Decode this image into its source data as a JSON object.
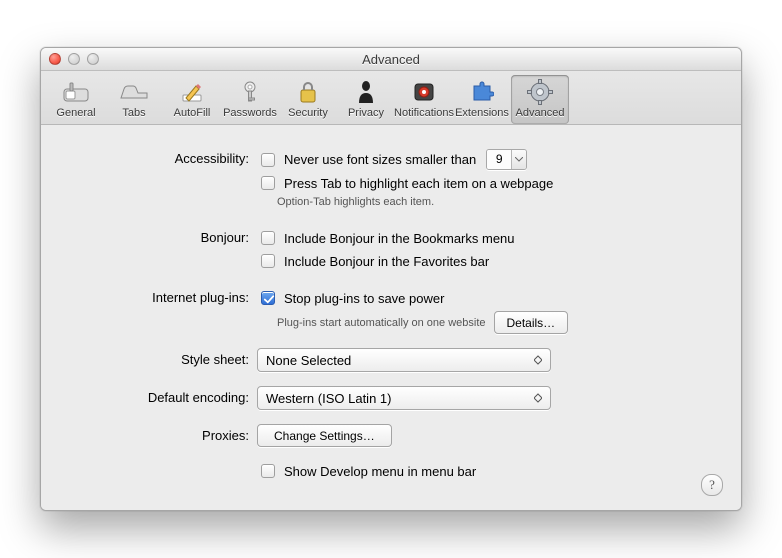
{
  "window": {
    "title": "Advanced"
  },
  "toolbar": {
    "items": [
      {
        "label": "General"
      },
      {
        "label": "Tabs"
      },
      {
        "label": "AutoFill"
      },
      {
        "label": "Passwords"
      },
      {
        "label": "Security"
      },
      {
        "label": "Privacy"
      },
      {
        "label": "Notifications"
      },
      {
        "label": "Extensions"
      },
      {
        "label": "Advanced",
        "selected": true
      }
    ]
  },
  "sections": {
    "accessibility": {
      "label": "Accessibility:",
      "never_font_size": "Never use font sizes smaller than",
      "font_size_value": "9",
      "press_tab": "Press Tab to highlight each item on a webpage",
      "option_tab_hint": "Option-Tab highlights each item."
    },
    "bonjour": {
      "label": "Bonjour:",
      "bookmarks": "Include Bonjour in the Bookmarks menu",
      "favorites": "Include Bonjour in the Favorites bar"
    },
    "plugins": {
      "label": "Internet plug-ins:",
      "stop_to_save": "Stop plug-ins to save power",
      "auto_hint": "Plug-ins start automatically on one website",
      "details_button": "Details…"
    },
    "stylesheet": {
      "label": "Style sheet:",
      "value": "None Selected"
    },
    "encoding": {
      "label": "Default encoding:",
      "value": "Western (ISO Latin 1)"
    },
    "proxies": {
      "label": "Proxies:",
      "button": "Change Settings…"
    },
    "develop": {
      "show_develop": "Show Develop menu in menu bar"
    }
  },
  "help": {
    "symbol": "?"
  }
}
